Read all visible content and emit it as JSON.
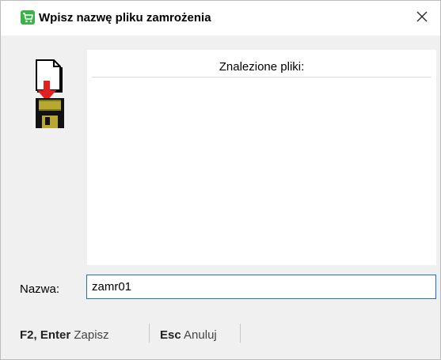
{
  "window": {
    "title": "Wpisz nazwę pliku zamrożenia",
    "title_icon": "shopping-cart-icon",
    "close_glyph": "✕",
    "accent_color": "#1c6ee0",
    "cart_icon_color": "#3bb34a"
  },
  "files_panel": {
    "header": "Znalezione pliki:",
    "items": []
  },
  "name_field": {
    "label": "Nazwa:",
    "value": "zamr01"
  },
  "footer": {
    "actions": [
      {
        "key": "F2, Enter",
        "label": "Zapisz"
      },
      {
        "key": "Esc",
        "label": "Anuluj"
      }
    ]
  },
  "icons": {
    "freeze": "save-document-to-disk-icon"
  }
}
